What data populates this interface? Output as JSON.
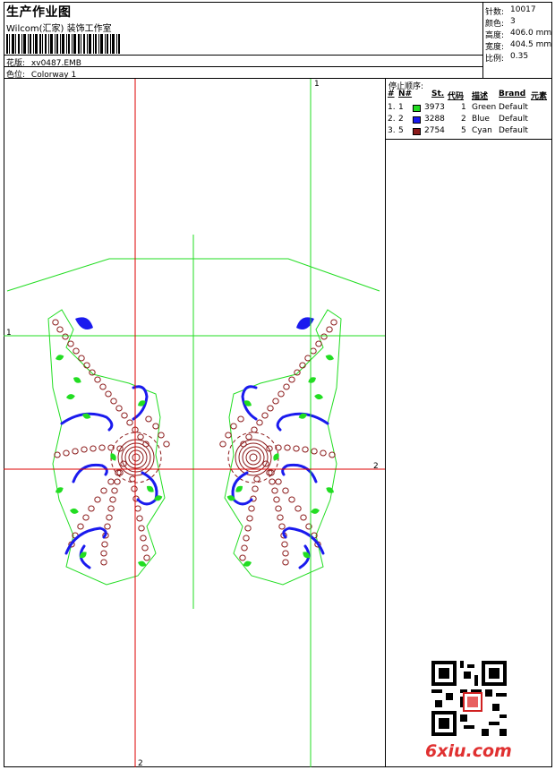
{
  "header": {
    "title": "生产作业图",
    "studio": "Wilcom(汇家) 装饰工作室",
    "design_label": "花版:",
    "design_value": "xv0487.EMB",
    "colorway_label": "色位:",
    "colorway_value": "Colorway 1"
  },
  "stats": [
    {
      "label": "针数:",
      "value": "10017"
    },
    {
      "label": "颜色:",
      "value": "3"
    },
    {
      "label": "高度:",
      "value": "406.0 mm"
    },
    {
      "label": "宽度:",
      "value": "404.5 mm"
    },
    {
      "label": "比例:",
      "value": "0.35"
    }
  ],
  "stop_sequence": {
    "title": "停止顺序:",
    "headers": [
      "#",
      "N#",
      "St.",
      "代码",
      "描述",
      "Brand",
      "元素"
    ],
    "rows": [
      {
        "idx": "1.",
        "n": "1",
        "color": "#22dd22",
        "stitches": "3973",
        "code": "1",
        "desc": "Green",
        "brand": "Default"
      },
      {
        "idx": "2.",
        "n": "2",
        "color": "#1a1aee",
        "stitches": "3288",
        "code": "2",
        "desc": "Blue",
        "brand": "Default"
      },
      {
        "idx": "3.",
        "n": "5",
        "color": "#8b1a1a",
        "stitches": "2754",
        "code": "5",
        "desc": "Cyan",
        "brand": "Default"
      }
    ]
  },
  "guides": {
    "vertical_1": "1",
    "vertical_2": "2",
    "horizontal_1": "1",
    "horizontal_2": "2"
  },
  "colors": {
    "green": "#22dd22",
    "blue": "#1a1aee",
    "red_guide": "#dd0000",
    "maroon": "#8b1a1a"
  },
  "watermark": "6xiu.com"
}
